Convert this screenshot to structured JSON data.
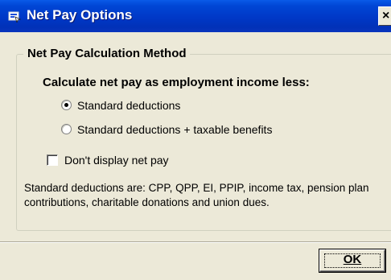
{
  "window": {
    "title": "Net Pay Options",
    "close_glyph": "×",
    "title_icon": "dialog-app-icon"
  },
  "group": {
    "legend": "Net Pay Calculation Method",
    "heading": "Calculate net pay as employment income less:",
    "options": [
      {
        "label": "Standard deductions",
        "selected": true
      },
      {
        "label": "Standard deductions + taxable benefits",
        "selected": false
      }
    ],
    "checkbox": {
      "label": "Don't display net pay",
      "checked": false
    },
    "note": "Standard deductions are: CPP, QPP, EI, PPIP, income tax, pension plan contributions, charitable donations and union dues."
  },
  "buttons": {
    "ok_label": "OK"
  },
  "colors": {
    "titlebar": "#0038c7",
    "dialog_bg": "#ece9d8",
    "group_border": "#d0d0bf"
  }
}
